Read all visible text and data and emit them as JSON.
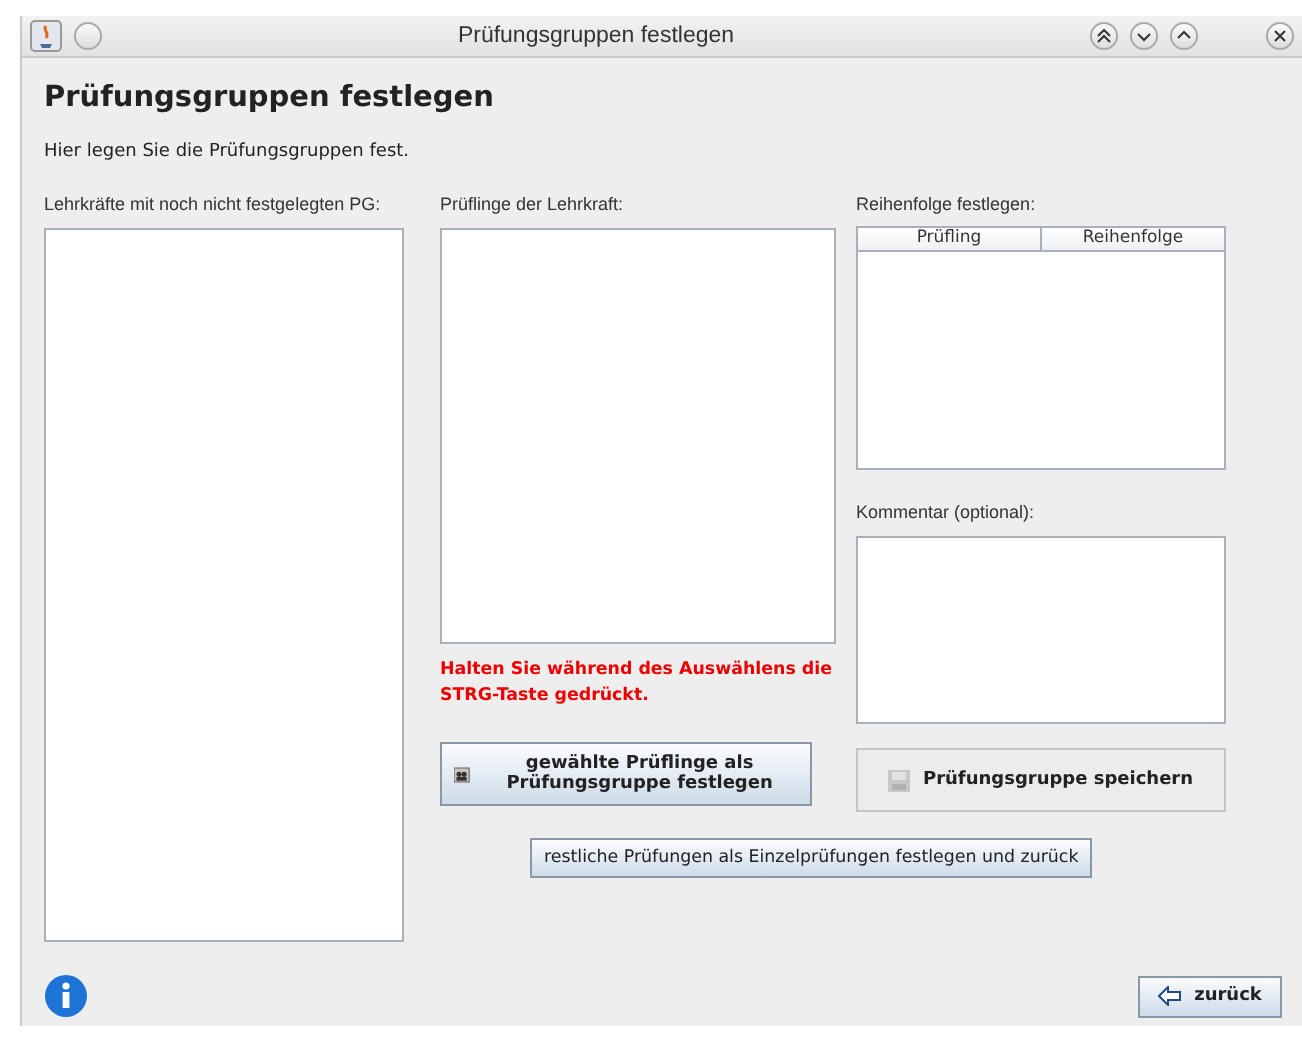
{
  "window": {
    "title": "Prüfungsgruppen festlegen"
  },
  "heading": "Prüfungsgruppen festlegen",
  "description": "Hier legen Sie die Prüfungsgruppen fest.",
  "teachers": {
    "label": "Lehrkräfte mit noch nicht festgelegten PG:"
  },
  "candidates": {
    "label": "Prüflinge der Lehrkraft:",
    "hint": "Halten Sie während des Auswählens die STRG-Taste gedrückt."
  },
  "order": {
    "label": "Reihenfolge festlegen:",
    "columns": [
      "Prüfling",
      "Reihenfolge"
    ]
  },
  "comment": {
    "label": "Kommentar (optional):"
  },
  "buttons": [
    {
      "label": "gewählte Prüflinge als Prüfungsgruppe festlegen",
      "disabled": false
    },
    {
      "label": "Prüfungsgruppe speichern",
      "disabled": true
    }
  ],
  "single_button": {
    "label": "restliche Prüfungen als Einzelprüfungen festlegen und zurück"
  },
  "back_button": {
    "label": "zurück"
  }
}
